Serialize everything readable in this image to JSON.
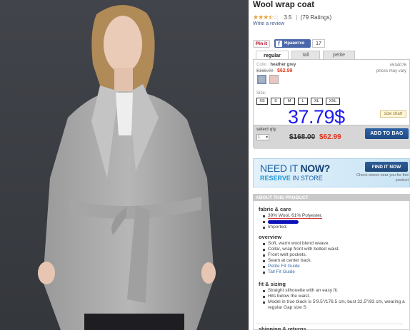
{
  "product": {
    "title": "Wool wrap coat",
    "rating_value": "3.5",
    "rating_count": "(79 Ratings)",
    "stars_filled": 3.5,
    "write_review": "Write a review"
  },
  "social": {
    "pin_label": "Pin it",
    "fb_label": "Нравится",
    "fb_count": "17"
  },
  "fit_tabs": [
    {
      "label": "regular",
      "active": true
    },
    {
      "label": "tall",
      "active": false
    },
    {
      "label": "petite",
      "active": false
    }
  ],
  "color": {
    "label": "Color :",
    "value": "heather grey",
    "price_old": "$168.00",
    "price_new": "$62.99",
    "sku": "#534076",
    "sku_note": "prices may vary"
  },
  "sizes": {
    "label": "Size:",
    "options": [
      "XS",
      "S",
      "M",
      "L",
      "XL",
      "XXL"
    ],
    "chart_label": "size chart"
  },
  "overlay_price": "37.79$",
  "buy": {
    "qty_label": "select qty",
    "qty_value": "1",
    "price_old": "$168.00",
    "price_new": "$62.99",
    "add_to_bag": "ADD TO BAG"
  },
  "store_banner": {
    "need": "NEED IT",
    "now": "NOW?",
    "reserve": "RESERVE",
    "in_store": "IN STORE",
    "find_button": "FIND IT NOW",
    "check_note": "Check stores near you for this product"
  },
  "about": {
    "header": "ABOUT THIS PRODUCT",
    "fabric_title": "fabric & care",
    "fabric_items": [
      "39% Wool, 61% Polyester.",
      "",
      "Imported."
    ],
    "overview_title": "overview",
    "overview_items": [
      "Soft, warm wool blend weave.",
      "Collar, wrap front with belted waist.",
      "Front welt pockets.",
      "Seam at center back."
    ],
    "overview_links": [
      "Petite Fit Guide",
      "Tall Fit Guide"
    ],
    "sizing_title": "fit & sizing",
    "sizing_items": [
      "Straight silhouette with an easy fit.",
      "Hits below the waist.",
      "Model in true black is 5'9.5\"/176.5 cm, bust 32.5\"/83 cm, wearing a regular Gap size S"
    ],
    "shipping_title": "shipping & returns"
  },
  "colors": {
    "accent_blue": "#1f4a84",
    "sale_red": "#e03a1e",
    "star": "#e2a23b"
  }
}
